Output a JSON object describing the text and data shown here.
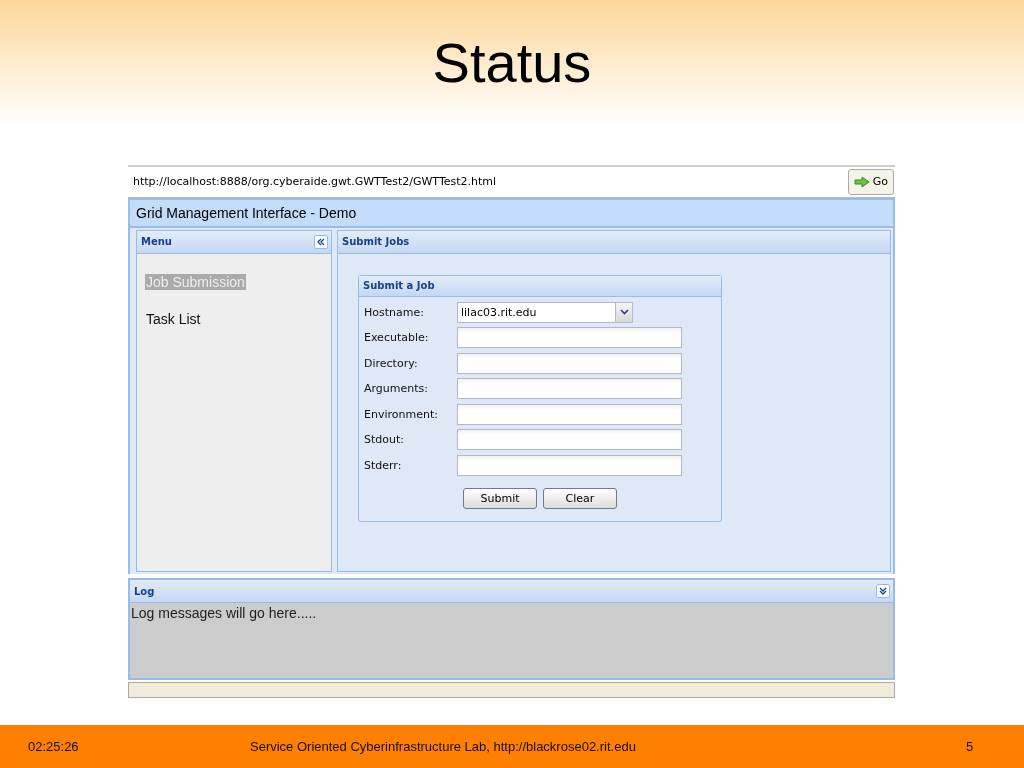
{
  "slide": {
    "title": "Status"
  },
  "browser": {
    "address": "http://localhost:8888/org.cyberaide.gwt.GWTTest2/GWTTest2.html",
    "go_button": "Go"
  },
  "app": {
    "title": "Grid Management Interface - Demo"
  },
  "menu_panel": {
    "title": "Menu",
    "items": [
      {
        "label": "Job Submission",
        "selected": true
      },
      {
        "label": "Task List",
        "selected": false
      }
    ]
  },
  "submit_panel": {
    "title": "Submit Jobs",
    "form": {
      "title": "Submit a Job",
      "fields": [
        {
          "label": "Hostname:",
          "kind": "select",
          "value": "lilac03.rit.edu"
        },
        {
          "label": "Executable:",
          "kind": "text"
        },
        {
          "label": "Directory:",
          "kind": "text"
        },
        {
          "label": "Arguments:",
          "kind": "text"
        },
        {
          "label": "Environment:",
          "kind": "text"
        },
        {
          "label": "Stdout:",
          "kind": "text"
        },
        {
          "label": "Stderr:",
          "kind": "text"
        }
      ],
      "buttons": [
        "Submit",
        "Clear"
      ]
    }
  },
  "log_panel": {
    "title": "Log",
    "message": "Log messages will go here....."
  },
  "footer": {
    "time": "02:25:26",
    "center": "Service Oriented Cyberinfrastructure Lab, http://blackrose02.rit.edu",
    "page": "5"
  }
}
